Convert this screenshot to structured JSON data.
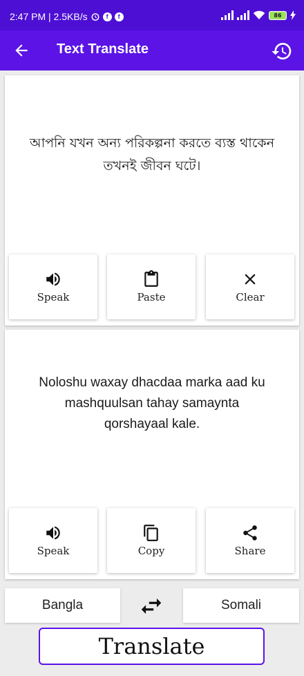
{
  "status_bar": {
    "time_speed": "2:47 PM | 2.5KB/s",
    "battery": "86"
  },
  "app_bar": {
    "title": "Text Translate"
  },
  "source": {
    "text": "আপনি যখন অন্য পরিকল্পনা করতে ব্যস্ত থাকেন তখনই জীবন ঘটে।",
    "buttons": {
      "speak": "Speak",
      "paste": "Paste",
      "clear": "Clear"
    }
  },
  "target": {
    "text": "Noloshu waxay dhacdaa marka aad ku mashquulsan tahay samaynta qorshayaal kale.",
    "buttons": {
      "speak": "Speak",
      "copy": "Copy",
      "share": "Share"
    }
  },
  "languages": {
    "source": "Bangla",
    "target": "Somali"
  },
  "translate_label": "Translate",
  "colors": {
    "status_bar": "#4d0fd4",
    "app_bar": "#5b13e6",
    "background": "#ececec",
    "accent_border": "#5b13e6"
  },
  "icons": [
    "back-arrow-icon",
    "history-icon",
    "speaker-icon",
    "clipboard-icon",
    "close-icon",
    "copy-icon",
    "share-icon",
    "swap-icon",
    "wifi-icon",
    "signal-icon",
    "battery-icon",
    "alarm-icon"
  ]
}
